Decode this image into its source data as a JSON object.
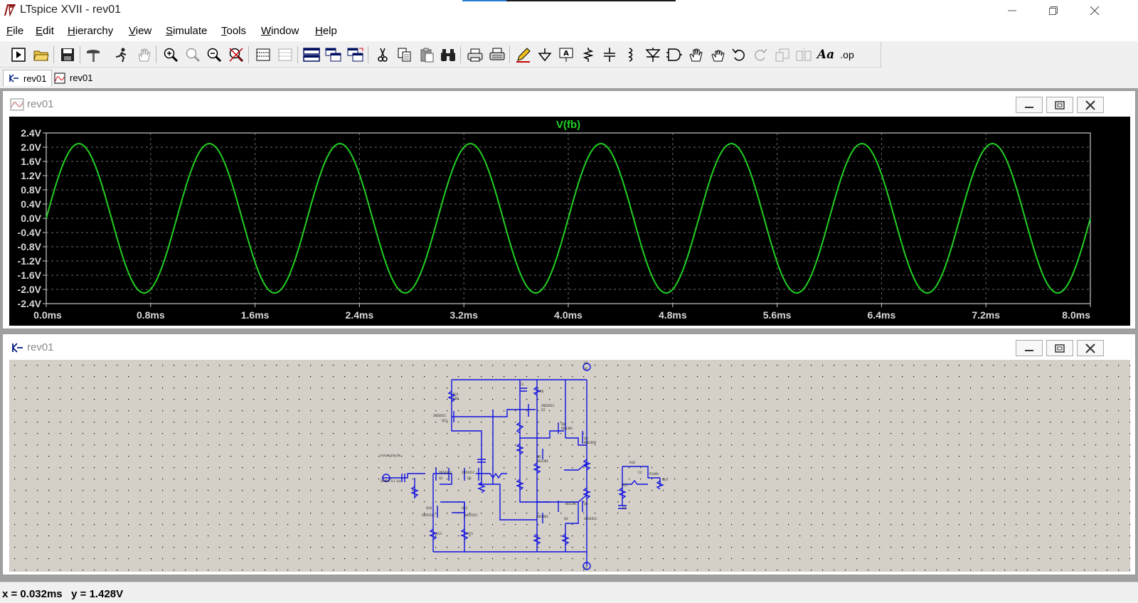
{
  "window": {
    "title": "LTspice XVII - rev01"
  },
  "menu": [
    "File",
    "Edit",
    "Hierarchy",
    "View",
    "Simulate",
    "Tools",
    "Window",
    "Help"
  ],
  "toolbar_right_text": {
    "font_label": "Aa",
    "op_label": ".op"
  },
  "tabs": [
    {
      "label": "rev01",
      "icon": "schematic-icon",
      "active": true
    },
    {
      "label": "rev01",
      "icon": "waveform-icon",
      "active": false
    }
  ],
  "waveform_window": {
    "title": "rev01"
  },
  "schematic_window": {
    "title": "rev01"
  },
  "status": {
    "text": "x = 0.032ms   y = 1.428V"
  },
  "colors": {
    "trace": "#22d022",
    "axis": "#c8c8c8",
    "plot_bg": "#000000",
    "wire": "#1010e0"
  },
  "chart_data": {
    "type": "line",
    "title": "V(fb)",
    "x_ticks": [
      "0.0ms",
      "0.8ms",
      "1.6ms",
      "2.4ms",
      "3.2ms",
      "4.0ms",
      "4.8ms",
      "5.6ms",
      "6.4ms",
      "7.2ms",
      "8.0ms"
    ],
    "y_ticks": [
      "2.4V",
      "2.0V",
      "1.6V",
      "1.2V",
      "0.8V",
      "0.4V",
      "0.0V",
      "-0.4V",
      "-0.8V",
      "-1.2V",
      "-1.6V",
      "-2.0V",
      "-2.4V"
    ],
    "xlim": [
      0,
      8
    ],
    "ylim": [
      -2.4,
      2.4
    ],
    "grid": true,
    "series": [
      {
        "name": "V(fb)",
        "amplitude": 2.1,
        "frequency_khz": 1.0,
        "phase_offset_ms": 0.0
      }
    ]
  }
}
